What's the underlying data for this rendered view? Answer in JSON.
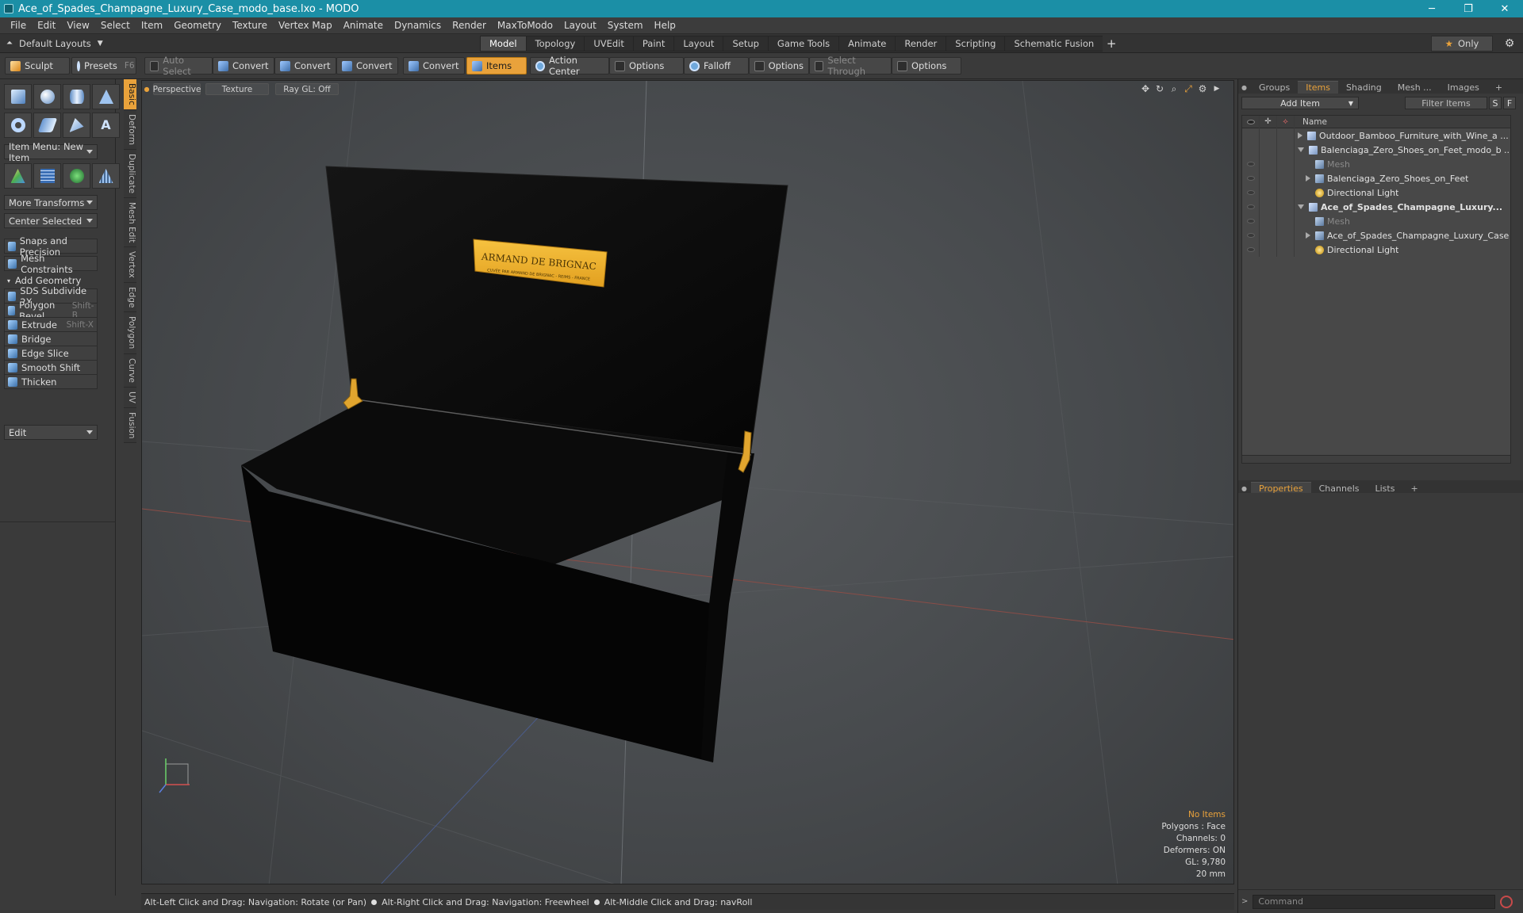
{
  "window": {
    "title": "Ace_of_Spades_Champagne_Luxury_Case_modo_base.lxo - MODO",
    "controls": {
      "minimize": "─",
      "maximize": "❐",
      "close": "✕"
    }
  },
  "menu": [
    "File",
    "Edit",
    "View",
    "Select",
    "Item",
    "Geometry",
    "Texture",
    "Vertex Map",
    "Animate",
    "Dynamics",
    "Render",
    "MaxToModo",
    "Layout",
    "System",
    "Help"
  ],
  "layout": {
    "preset": "Default Layouts",
    "tabs": [
      "Model",
      "Topology",
      "UVEdit",
      "Paint",
      "Layout",
      "Setup",
      "Game Tools",
      "Animate",
      "Render",
      "Scripting",
      "Schematic Fusion"
    ],
    "active_tab": "Model",
    "add_tab": "+",
    "only_label": "Only",
    "only_star": "★"
  },
  "toolbar": {
    "sculpt": "Sculpt",
    "presets": "Presets",
    "presets_key": "F6",
    "auto_select": "Auto Select",
    "convert1": "Convert",
    "convert2": "Convert",
    "convert3": "Convert",
    "convert4": "Convert",
    "items": "Items",
    "action_center": "Action Center",
    "options1": "Options",
    "falloff": "Falloff",
    "options2": "Options",
    "select_through": "Select Through",
    "options3": "Options"
  },
  "left": {
    "item_menu": "Item Menu: New Item",
    "more_transforms": "More Transforms",
    "center_selected": "Center Selected",
    "snaps": "Snaps and Precision",
    "mesh_constraints": "Mesh Constraints",
    "add_geometry": "Add Geometry",
    "tools": [
      {
        "label": "SDS Subdivide 2X",
        "key": ""
      },
      {
        "label": "Polygon Bevel",
        "key": "Shift-B"
      },
      {
        "label": "Extrude",
        "key": "Shift-X"
      },
      {
        "label": "Bridge",
        "key": ""
      },
      {
        "label": "Edge Slice",
        "key": ""
      },
      {
        "label": "Smooth Shift",
        "key": ""
      },
      {
        "label": "Thicken",
        "key": ""
      }
    ],
    "edit": "Edit",
    "vertical_tabs": [
      "Basic",
      "Deform",
      "Duplicate",
      "Mesh Edit",
      "Vertex",
      "Edge",
      "Polygon",
      "Curve",
      "UV",
      "Fusion"
    ]
  },
  "viewport": {
    "view": "Perspective",
    "shading": "Texture",
    "raygl": "Ray GL: Off",
    "plaque_title": "ARMAND DE BRIGNAC",
    "plaque_sub": "CUVÉE PAR ARMAND DE BRIGNAC - REIMS - FRANCE",
    "stats": {
      "selection": "No Items",
      "polygons": "Polygons : Face",
      "channels": "Channels: 0",
      "deformers": "Deformers: ON",
      "gl": "GL: 9,780",
      "scale": "20 mm"
    }
  },
  "status_bar": {
    "hint1": "Alt-Left Click and Drag: Navigation: Rotate (or Pan)",
    "hint2": "Alt-Right Click and Drag: Navigation: Freewheel",
    "hint3": "Alt-Middle Click and Drag: navRoll"
  },
  "right": {
    "tabs": [
      "Groups",
      "Items",
      "Shading",
      "Mesh ...",
      "Images"
    ],
    "active_tab": "Items",
    "add_item": "Add Item",
    "filter_items": "Filter Items",
    "btn_s": "S",
    "btn_f": "F",
    "column_name": "Name",
    "tree": [
      {
        "label": "Outdoor_Bamboo_Furniture_with_Wine_a ...",
        "indent": 0,
        "expander": "right",
        "icon": "scene",
        "eye": false,
        "bold": false,
        "faint": false
      },
      {
        "label": "Balenciaga_Zero_Shoes_on_Feet_modo_b ...",
        "indent": 0,
        "expander": "down",
        "icon": "scene",
        "eye": false,
        "bold": false,
        "faint": false
      },
      {
        "label": "Mesh",
        "indent": 1,
        "expander": "",
        "icon": "mesh",
        "eye": true,
        "bold": false,
        "faint": true
      },
      {
        "label": "Balenciaga_Zero_Shoes_on_Feet",
        "indent": 1,
        "expander": "right",
        "icon": "mesh",
        "eye": true,
        "bold": false,
        "faint": false
      },
      {
        "label": "Directional Light",
        "indent": 1,
        "expander": "",
        "icon": "light",
        "eye": true,
        "bold": false,
        "faint": false
      },
      {
        "label": "Ace_of_Spades_Champagne_Luxury...",
        "indent": 0,
        "expander": "down",
        "icon": "scene",
        "eye": true,
        "bold": true,
        "faint": false
      },
      {
        "label": "Mesh",
        "indent": 1,
        "expander": "",
        "icon": "mesh",
        "eye": true,
        "bold": false,
        "faint": true
      },
      {
        "label": "Ace_of_Spades_Champagne_Luxury_Case",
        "indent": 1,
        "expander": "right",
        "icon": "mesh",
        "eye": true,
        "bold": false,
        "faint": false
      },
      {
        "label": "Directional Light",
        "indent": 1,
        "expander": "",
        "icon": "light",
        "eye": true,
        "bold": false,
        "faint": false
      }
    ],
    "prop_tabs": [
      "Properties",
      "Channels",
      "Lists"
    ],
    "prop_active": "Properties",
    "command_placeholder": "Command"
  },
  "colors": {
    "accent": "#e9a23b",
    "titlebar": "#1b8fa6",
    "case": "#0a0a0a",
    "plaque": "#f0b429"
  }
}
